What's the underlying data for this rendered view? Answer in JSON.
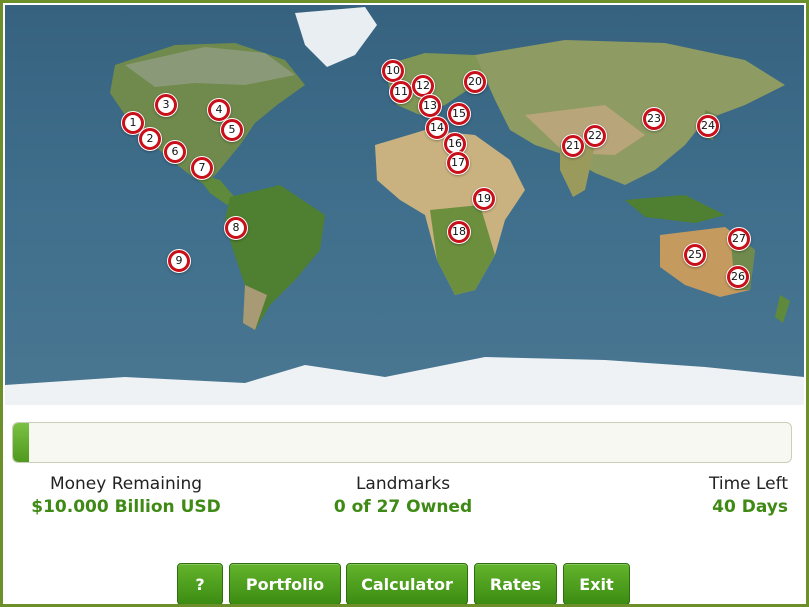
{
  "map": {
    "landmarks": [
      "1",
      "2",
      "3",
      "4",
      "5",
      "6",
      "7",
      "8",
      "9",
      "10",
      "11",
      "12",
      "13",
      "14",
      "15",
      "16",
      "17",
      "18",
      "19",
      "20",
      "21",
      "22",
      "23",
      "24",
      "25",
      "26",
      "27"
    ]
  },
  "progress": {
    "fraction": 0.02
  },
  "stats": {
    "money_label": "Money Remaining",
    "money_value": "$10.000 Billion USD",
    "landmarks_label": "Landmarks",
    "landmarks_value": "0 of 27 Owned",
    "time_label": "Time Left",
    "time_value": "40 Days"
  },
  "buttons": {
    "help": "?",
    "portfolio": "Portfolio",
    "calculator": "Calculator",
    "rates": "Rates",
    "exit": "Exit"
  },
  "colors": {
    "frame": "#6d8f2a",
    "ocean": "#3f6a86",
    "accent_green": "#3e8a14",
    "marker_ring": "#c8101a"
  }
}
